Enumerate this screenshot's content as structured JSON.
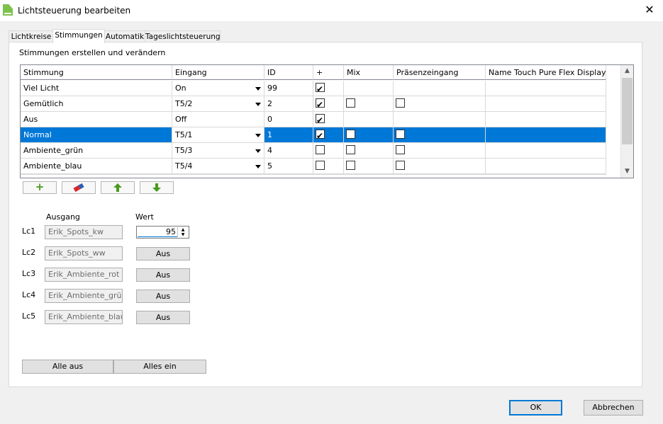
{
  "window": {
    "title": "Lichtsteuerung bearbeiten",
    "close_glyph": "✕"
  },
  "tabs": [
    {
      "label": "Lichtkreise",
      "active": false
    },
    {
      "label": "Stimmungen",
      "active": true
    },
    {
      "label": "Automatik",
      "active": false
    },
    {
      "label": "Tageslichtsteuerung",
      "active": false
    }
  ],
  "section_title": "Stimmungen erstellen und verändern",
  "grid": {
    "columns": [
      "Stimmung",
      "Eingang",
      "ID",
      "+",
      "Mix",
      "Präsenzeingang",
      "Name Touch Pure Flex Display"
    ],
    "rows": [
      {
        "stimmung": "Viel Licht",
        "eingang": "On",
        "dropdown": true,
        "id": "99",
        "plus": true,
        "mix": null,
        "praesenz": null,
        "selected": false
      },
      {
        "stimmung": "Gemütlich",
        "eingang": "T5/2",
        "dropdown": true,
        "id": "2",
        "plus": true,
        "mix": false,
        "praesenz": false,
        "selected": false
      },
      {
        "stimmung": "Aus",
        "eingang": "Off",
        "dropdown": false,
        "id": "0",
        "plus": true,
        "mix": null,
        "praesenz": null,
        "selected": false
      },
      {
        "stimmung": "Normal",
        "eingang": "T5/1",
        "dropdown": true,
        "id": "1",
        "plus": true,
        "mix": false,
        "praesenz": false,
        "selected": true
      },
      {
        "stimmung": "Ambiente_grün",
        "eingang": "T5/3",
        "dropdown": true,
        "id": "4",
        "plus": false,
        "mix": false,
        "praesenz": false,
        "selected": false
      },
      {
        "stimmung": "Ambiente_blau",
        "eingang": "T5/4",
        "dropdown": true,
        "id": "5",
        "plus": false,
        "mix": false,
        "praesenz": false,
        "selected": false
      }
    ],
    "scroll_up": "▲",
    "scroll_down": "▼"
  },
  "toolbar": {
    "add_icon": "add-icon",
    "erase_icon": "eraser-icon",
    "up_icon": "arrow-up-icon",
    "down_icon": "arrow-down-icon",
    "add_glyph": "+",
    "accent_green": "#4a9a1c",
    "eraser_red": "#d9262c"
  },
  "outputs": {
    "header_output": "Ausgang",
    "header_value": "Wert",
    "rows": [
      {
        "label": "Lc1",
        "name": "Erik_Spots_kw",
        "value": "95",
        "kind": "spinner"
      },
      {
        "label": "Lc2",
        "name": "Erik_Spots_ww",
        "value": "Aus",
        "kind": "button"
      },
      {
        "label": "Lc3",
        "name": "Erik_Ambiente_rot",
        "value": "Aus",
        "kind": "button"
      },
      {
        "label": "Lc4",
        "name": "Erik_Ambiente_grün",
        "value": "Aus",
        "kind": "button"
      },
      {
        "label": "Lc5",
        "name": "Erik_Ambiente_blau",
        "value": "Aus",
        "kind": "button"
      }
    ]
  },
  "bottom": {
    "all_off": "Alle aus",
    "all_on": "Alles ein"
  },
  "dialog": {
    "ok": "OK",
    "cancel": "Abbrechen"
  },
  "colors": {
    "selection": "#0078d7",
    "app_icon": "#7dc24b"
  }
}
